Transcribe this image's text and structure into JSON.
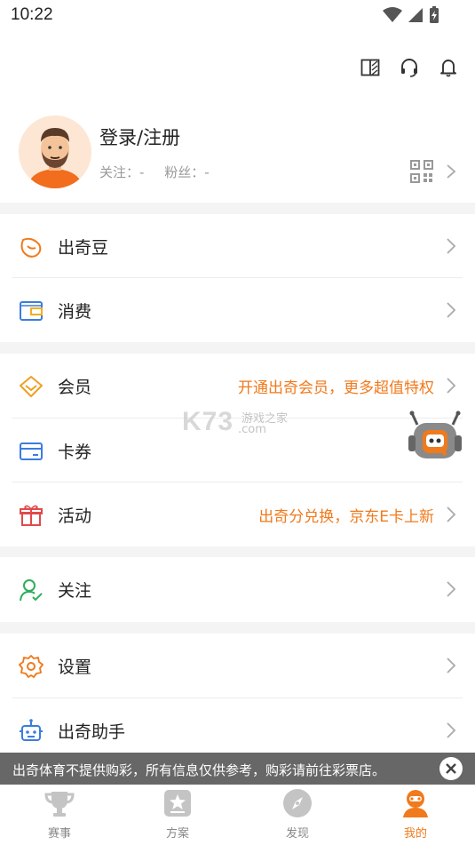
{
  "status_bar": {
    "time": "10:22"
  },
  "profile": {
    "login_label": "登录/注册",
    "follow_label": "关注：-",
    "fans_label": "粉丝：-"
  },
  "menu": {
    "beans": {
      "label": "出奇豆"
    },
    "consume": {
      "label": "消费"
    },
    "member": {
      "label": "会员",
      "promo": "开通出奇会员，更多超值特权"
    },
    "coupon": {
      "label": "卡券"
    },
    "activity": {
      "label": "活动",
      "promo": "出奇分兑换，京东E卡上新"
    },
    "follow": {
      "label": "关注"
    },
    "settings": {
      "label": "设置"
    },
    "assistant": {
      "label": "出奇助手"
    }
  },
  "watermark": {
    "logo": "K73",
    "tagline": "游戏之家",
    "domain": ".com"
  },
  "notice": {
    "text": "出奇体育不提供购彩，所有信息仅供参考，购彩请前往彩票店。"
  },
  "tabs": [
    {
      "label": "赛事"
    },
    {
      "label": "方案"
    },
    {
      "label": "发现"
    },
    {
      "label": "我的"
    }
  ],
  "colors": {
    "accent": "#f07a1c",
    "divider": "#ececec",
    "section_gap": "#f4f4f4"
  }
}
